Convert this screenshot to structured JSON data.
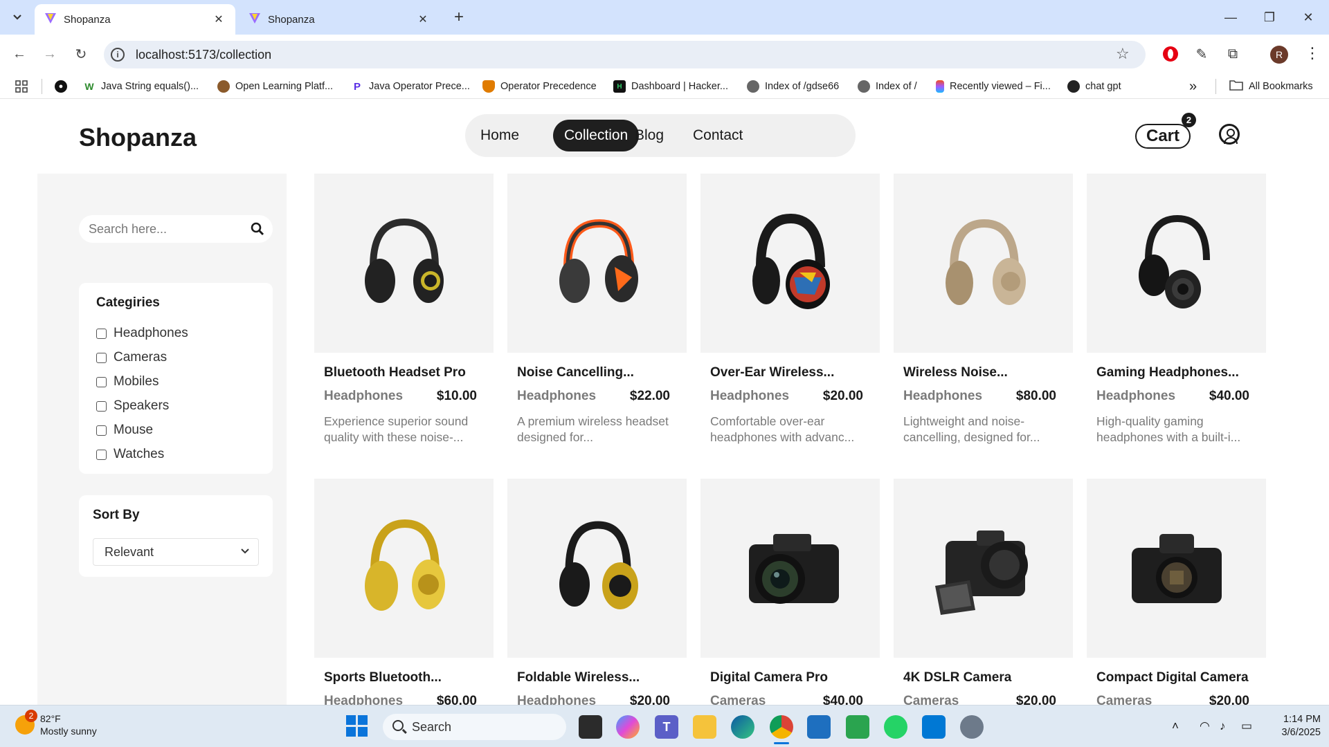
{
  "browser": {
    "tabs": [
      {
        "title": "Shopanza",
        "active": true
      },
      {
        "title": "Shopanza",
        "active": false
      }
    ],
    "new_tab_symbol": "+",
    "url": "localhost:5173/collection",
    "profile_initial": "R",
    "bookmarks": [
      {
        "label": "Java String equals()...",
        "icon": "w-icon"
      },
      {
        "label": "Open Learning Platf...",
        "icon": "owl-icon"
      },
      {
        "label": "Java Operator Prece...",
        "icon": "p-icon"
      },
      {
        "label": "Operator Precedence",
        "icon": "shield-icon"
      },
      {
        "label": "Dashboard | Hacker...",
        "icon": "hackerrank-icon"
      },
      {
        "label": "Index of /gdse66",
        "icon": "globe-icon"
      },
      {
        "label": "Index of /",
        "icon": "globe-icon"
      },
      {
        "label": "Recently viewed – Fi...",
        "icon": "figma-icon"
      },
      {
        "label": "chat gpt",
        "icon": "openai-icon"
      }
    ],
    "bookmarks_overflow": "»",
    "all_bookmarks": "All Bookmarks"
  },
  "site": {
    "brand": "Shopanza",
    "nav": [
      {
        "label": "Home",
        "active": false
      },
      {
        "label": "Collection",
        "active": true
      },
      {
        "label": "Blog",
        "active": false
      },
      {
        "label": "Contact",
        "active": false
      }
    ],
    "cart_label": "Cart",
    "cart_count": "2"
  },
  "sidebar": {
    "search_placeholder": "Search here...",
    "categories_title": "Categiries",
    "categories": [
      "Headphones",
      "Cameras",
      "Mobiles",
      "Speakers",
      "Mouse",
      "Watches"
    ],
    "sort_title": "Sort By",
    "sort_selected": "Relevant"
  },
  "products": [
    {
      "name": "Bluetooth Headset Pro",
      "category": "Headphones",
      "price": "$10.00",
      "desc": "Experience superior sound quality with these noise-...",
      "image": "headphones-black-yellow"
    },
    {
      "name": "Noise Cancelling...",
      "category": "Headphones",
      "price": "$22.00",
      "desc": "A premium wireless headset designed for...",
      "image": "headphones-orange-gaming"
    },
    {
      "name": "Over-Ear Wireless...",
      "category": "Headphones",
      "price": "$20.00",
      "desc": "Comfortable over-ear headphones with advanc...",
      "image": "headphones-pattern"
    },
    {
      "name": "Wireless Noise...",
      "category": "Headphones",
      "price": "$80.00",
      "desc": "Lightweight and noise-cancelling, designed for...",
      "image": "headphones-beige"
    },
    {
      "name": "Gaming Headphones...",
      "category": "Headphones",
      "price": "$40.00",
      "desc": "High-quality gaming headphones with a built-i...",
      "image": "headphones-dj-black"
    },
    {
      "name": "Sports Bluetooth...",
      "category": "Headphones",
      "price": "$60.00",
      "desc": "",
      "image": "headphones-gold"
    },
    {
      "name": "Foldable Wireless...",
      "category": "Headphones",
      "price": "$20.00",
      "desc": "",
      "image": "headphones-black-gold"
    },
    {
      "name": "Digital Camera Pro",
      "category": "Cameras",
      "price": "$40.00",
      "desc": "",
      "image": "camera-dslr-lens"
    },
    {
      "name": "4K DSLR Camera",
      "category": "Cameras",
      "price": "$20.00",
      "desc": "",
      "image": "camera-dslr-flip"
    },
    {
      "name": "Compact Digital Camera",
      "category": "Cameras",
      "price": "$20.00",
      "desc": "",
      "image": "camera-body"
    }
  ],
  "taskbar": {
    "weather_badge": "2",
    "weather_temp": "82°F",
    "weather_desc": "Mostly sunny",
    "search_label": "Search",
    "time": "1:14 PM",
    "date": "3/6/2025"
  }
}
